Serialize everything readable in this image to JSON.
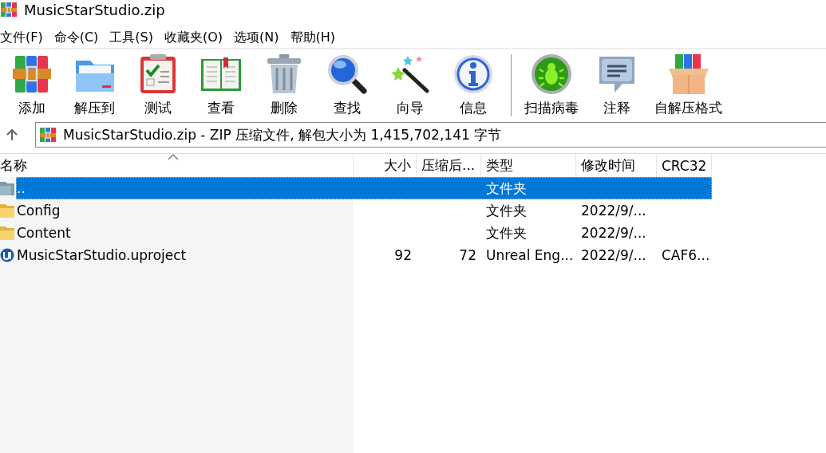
{
  "window": {
    "title": "MusicStarStudio.zip"
  },
  "menu": [
    {
      "label": "文件(F)"
    },
    {
      "label": "命令(C)"
    },
    {
      "label": "工具(S)"
    },
    {
      "label": "收藏夹(O)"
    },
    {
      "label": "选项(N)"
    },
    {
      "label": "帮助(H)"
    }
  ],
  "toolbar_groups": [
    [
      {
        "label": "添加",
        "kind": "add"
      },
      {
        "label": "解压到",
        "kind": "extract"
      },
      {
        "label": "测试",
        "kind": "test"
      },
      {
        "label": "查看",
        "kind": "view"
      },
      {
        "label": "删除",
        "kind": "delete"
      },
      {
        "label": "查找",
        "kind": "find"
      },
      {
        "label": "向导",
        "kind": "wizard"
      },
      {
        "label": "信息",
        "kind": "info"
      }
    ],
    [
      {
        "label": "扫描病毒",
        "kind": "scan"
      },
      {
        "label": "注释",
        "kind": "comment"
      },
      {
        "label": "自解压格式",
        "kind": "sfx"
      }
    ]
  ],
  "address": {
    "value": "MusicStarStudio.zip - ZIP 压缩文件, 解包大小为 1,415,702,141 字节"
  },
  "file_list": {
    "columns": [
      {
        "label": "名称",
        "sorted": true
      },
      {
        "label": "大小",
        "sorted": false
      },
      {
        "label": "压缩后...",
        "sorted": false
      },
      {
        "label": "类型",
        "sorted": false
      },
      {
        "label": "修改时间",
        "sorted": false
      },
      {
        "label": "CRC32",
        "sorted": false
      }
    ],
    "rows": [
      {
        "kind": "parent",
        "name": "..",
        "type": "文件夹",
        "selected": true
      },
      {
        "kind": "folder",
        "name": "Config",
        "type": "文件夹",
        "modified": "2022/9/...",
        "selected": false
      },
      {
        "kind": "folder",
        "name": "Content",
        "type": "文件夹",
        "modified": "2022/9/...",
        "selected": false
      },
      {
        "kind": "uproject",
        "name": "MusicStarStudio.uproject",
        "size": "92",
        "packed": "72",
        "type": "Unreal Eng...",
        "modified": "2022/9/...",
        "crc": "CAF6...",
        "selected": false
      }
    ]
  }
}
